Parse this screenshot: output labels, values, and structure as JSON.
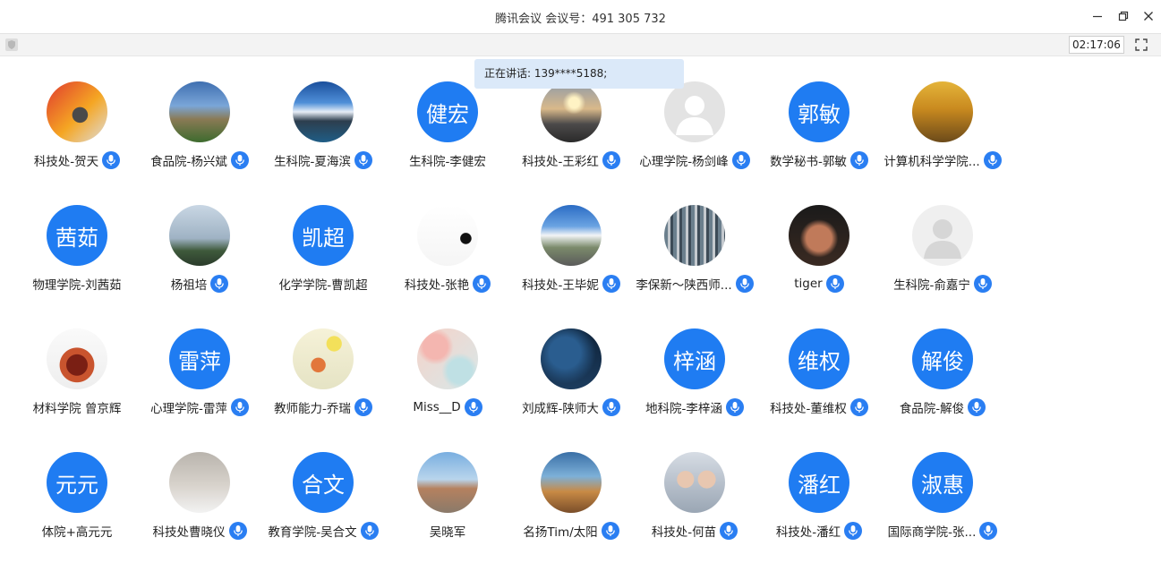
{
  "window": {
    "title": "腾讯会议 会议号：491 305 732"
  },
  "toolbar": {
    "timer": "02:17:06"
  },
  "speaking": {
    "text": "正在讲话: 139****5188;"
  },
  "colors": {
    "accent": "#1f7cf2",
    "mic": "#2a7ef2",
    "speaking_bg": "#dbe9f9"
  },
  "participants": [
    {
      "name": "科技处-贺天",
      "avatar": "photo-person-red",
      "mic": true
    },
    {
      "name": "食品院-杨兴斌",
      "avatar": "photo-landscape-castle",
      "mic": true
    },
    {
      "name": "生科院-夏海滨",
      "avatar": "photo-mountain-lake",
      "mic": true
    },
    {
      "name": "生科院-李健宏",
      "avatar_text": "健宏",
      "mic": false
    },
    {
      "name": "科技处-王彩红",
      "avatar": "photo-sunset-beach",
      "mic": true
    },
    {
      "name": "心理学院-杨剑峰",
      "avatar": "default-gray",
      "mic": true
    },
    {
      "name": "数学秘书-郭敏",
      "avatar_text": "郭敏",
      "mic": true
    },
    {
      "name": "计算机科学学院...",
      "avatar": "photo-golden-trees",
      "mic": true
    },
    {
      "name": "物理学院-刘茜茹",
      "avatar_text": "茜茹",
      "mic": false
    },
    {
      "name": "杨祖培",
      "avatar": "photo-sky-trees",
      "mic": true
    },
    {
      "name": "化学学院-曹凯超",
      "avatar_text": "凯超",
      "mic": false
    },
    {
      "name": "科技处-张艳",
      "avatar": "photo-cat-silhouette",
      "mic": true
    },
    {
      "name": "科技处-王毕妮",
      "avatar": "photo-clouds-road",
      "mic": true
    },
    {
      "name": "李保新～陕西师...",
      "avatar": "photo-bookshelf",
      "mic": true
    },
    {
      "name": "tiger",
      "avatar": "photo-muscle-man",
      "mic": true
    },
    {
      "name": "生科院-俞嘉宁",
      "avatar": "default-light",
      "mic": true
    },
    {
      "name": "材料学院 曾京辉",
      "avatar": "photo-teapot",
      "mic": false
    },
    {
      "name": "心理学院-雷萍",
      "avatar_text": "雷萍",
      "mic": true
    },
    {
      "name": "教师能力-乔瑞",
      "avatar": "photo-mushroom",
      "mic": true
    },
    {
      "name": "Miss__D",
      "avatar": "photo-pink-abstract",
      "mic": true
    },
    {
      "name": "刘成辉-陕师大",
      "avatar": "photo-night-sky",
      "mic": true
    },
    {
      "name": "地科院-李梓涵",
      "avatar_text": "梓涵",
      "mic": true
    },
    {
      "name": "科技处-董维权",
      "avatar_text": "维权",
      "mic": true
    },
    {
      "name": "食品院-解俊",
      "avatar_text": "解俊",
      "mic": true
    },
    {
      "name": "体院+高元元",
      "avatar_text": "元元",
      "mic": false
    },
    {
      "name": "科技处曹晓仪",
      "avatar": "photo-snow-tree",
      "mic": true
    },
    {
      "name": "教育学院-吴合文",
      "avatar_text": "合文",
      "mic": true
    },
    {
      "name": "吴晓军",
      "avatar": "photo-building",
      "mic": false
    },
    {
      "name": "名扬Tim/太阳",
      "avatar": "photo-badminton",
      "mic": true
    },
    {
      "name": "科技处-何苗",
      "avatar": "photo-two-women",
      "mic": true
    },
    {
      "name": "科技处-潘红",
      "avatar_text": "潘红",
      "mic": true
    },
    {
      "name": "国际商学院-张...",
      "avatar_text": "淑惠",
      "mic": true
    }
  ]
}
